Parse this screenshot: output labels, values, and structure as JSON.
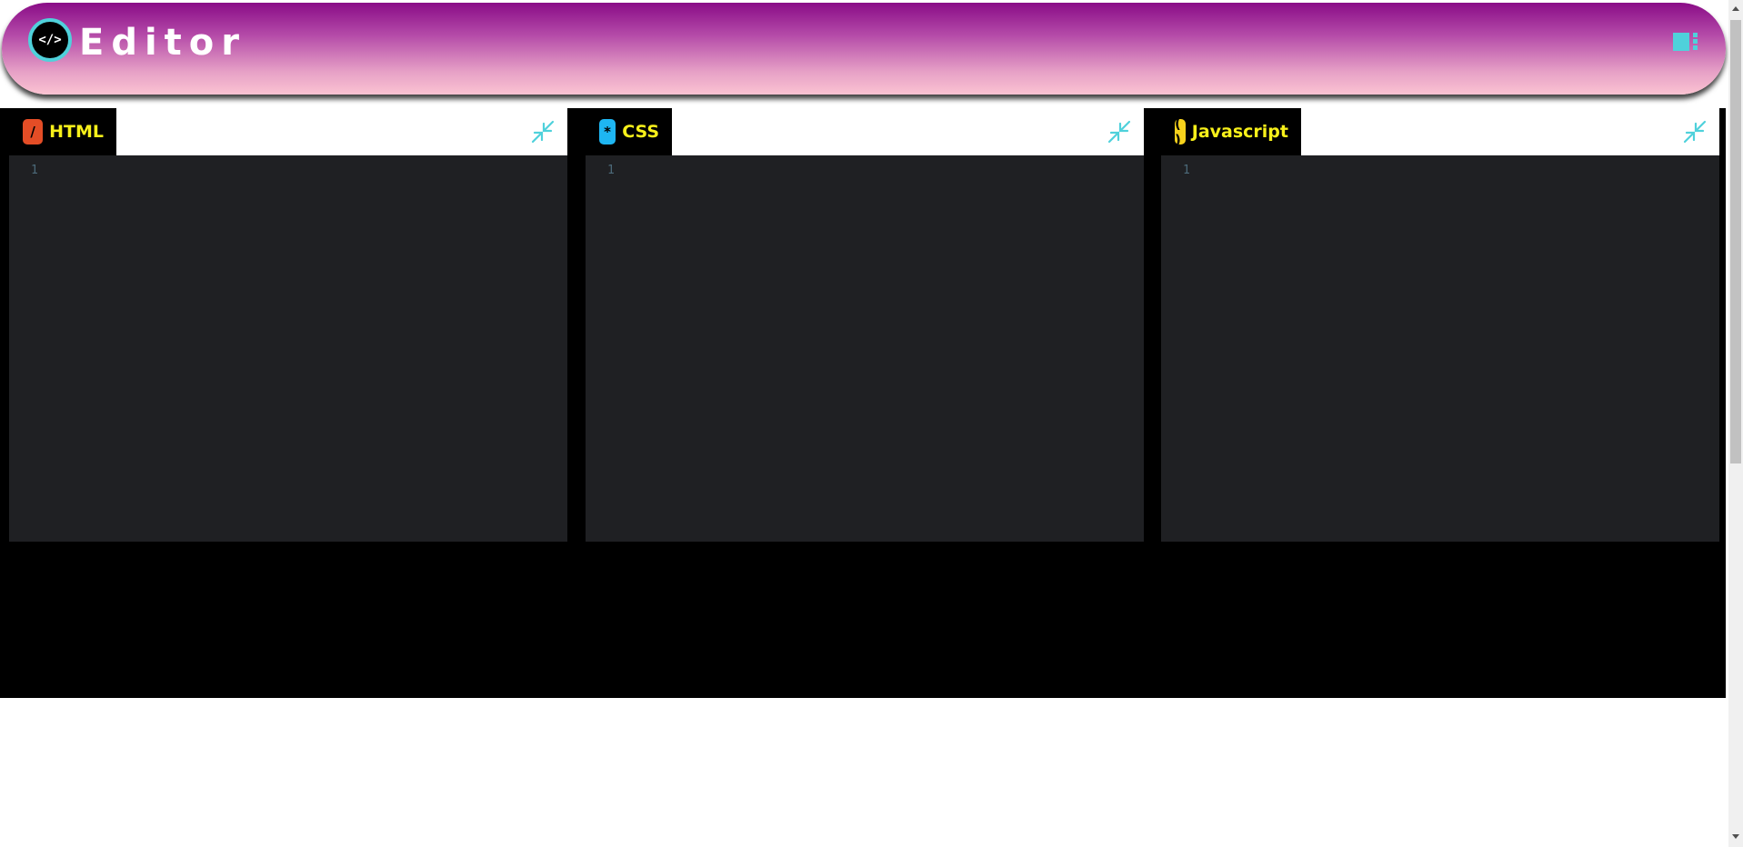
{
  "header": {
    "logo_text": "</>",
    "title": "Editor",
    "layout_icon": "layout-toggle-icon"
  },
  "panels": [
    {
      "label": "HTML",
      "icon_glyph": "/",
      "icon_color": "#e44d26",
      "icon_text_color": "#000000",
      "line_number": "1"
    },
    {
      "label": "CSS",
      "icon_glyph": "*",
      "icon_color": "#1eb6f2",
      "icon_text_color": "#000000",
      "line_number": "1"
    },
    {
      "label": "Javascript",
      "icon_glyph": "( )",
      "icon_color": "#f7d21c",
      "icon_text_color": "#000000",
      "line_number": "1"
    }
  ],
  "colors": {
    "accent": "#4fd1db",
    "tab_label": "#f7f01a",
    "editor_bg": "#1f2023"
  }
}
